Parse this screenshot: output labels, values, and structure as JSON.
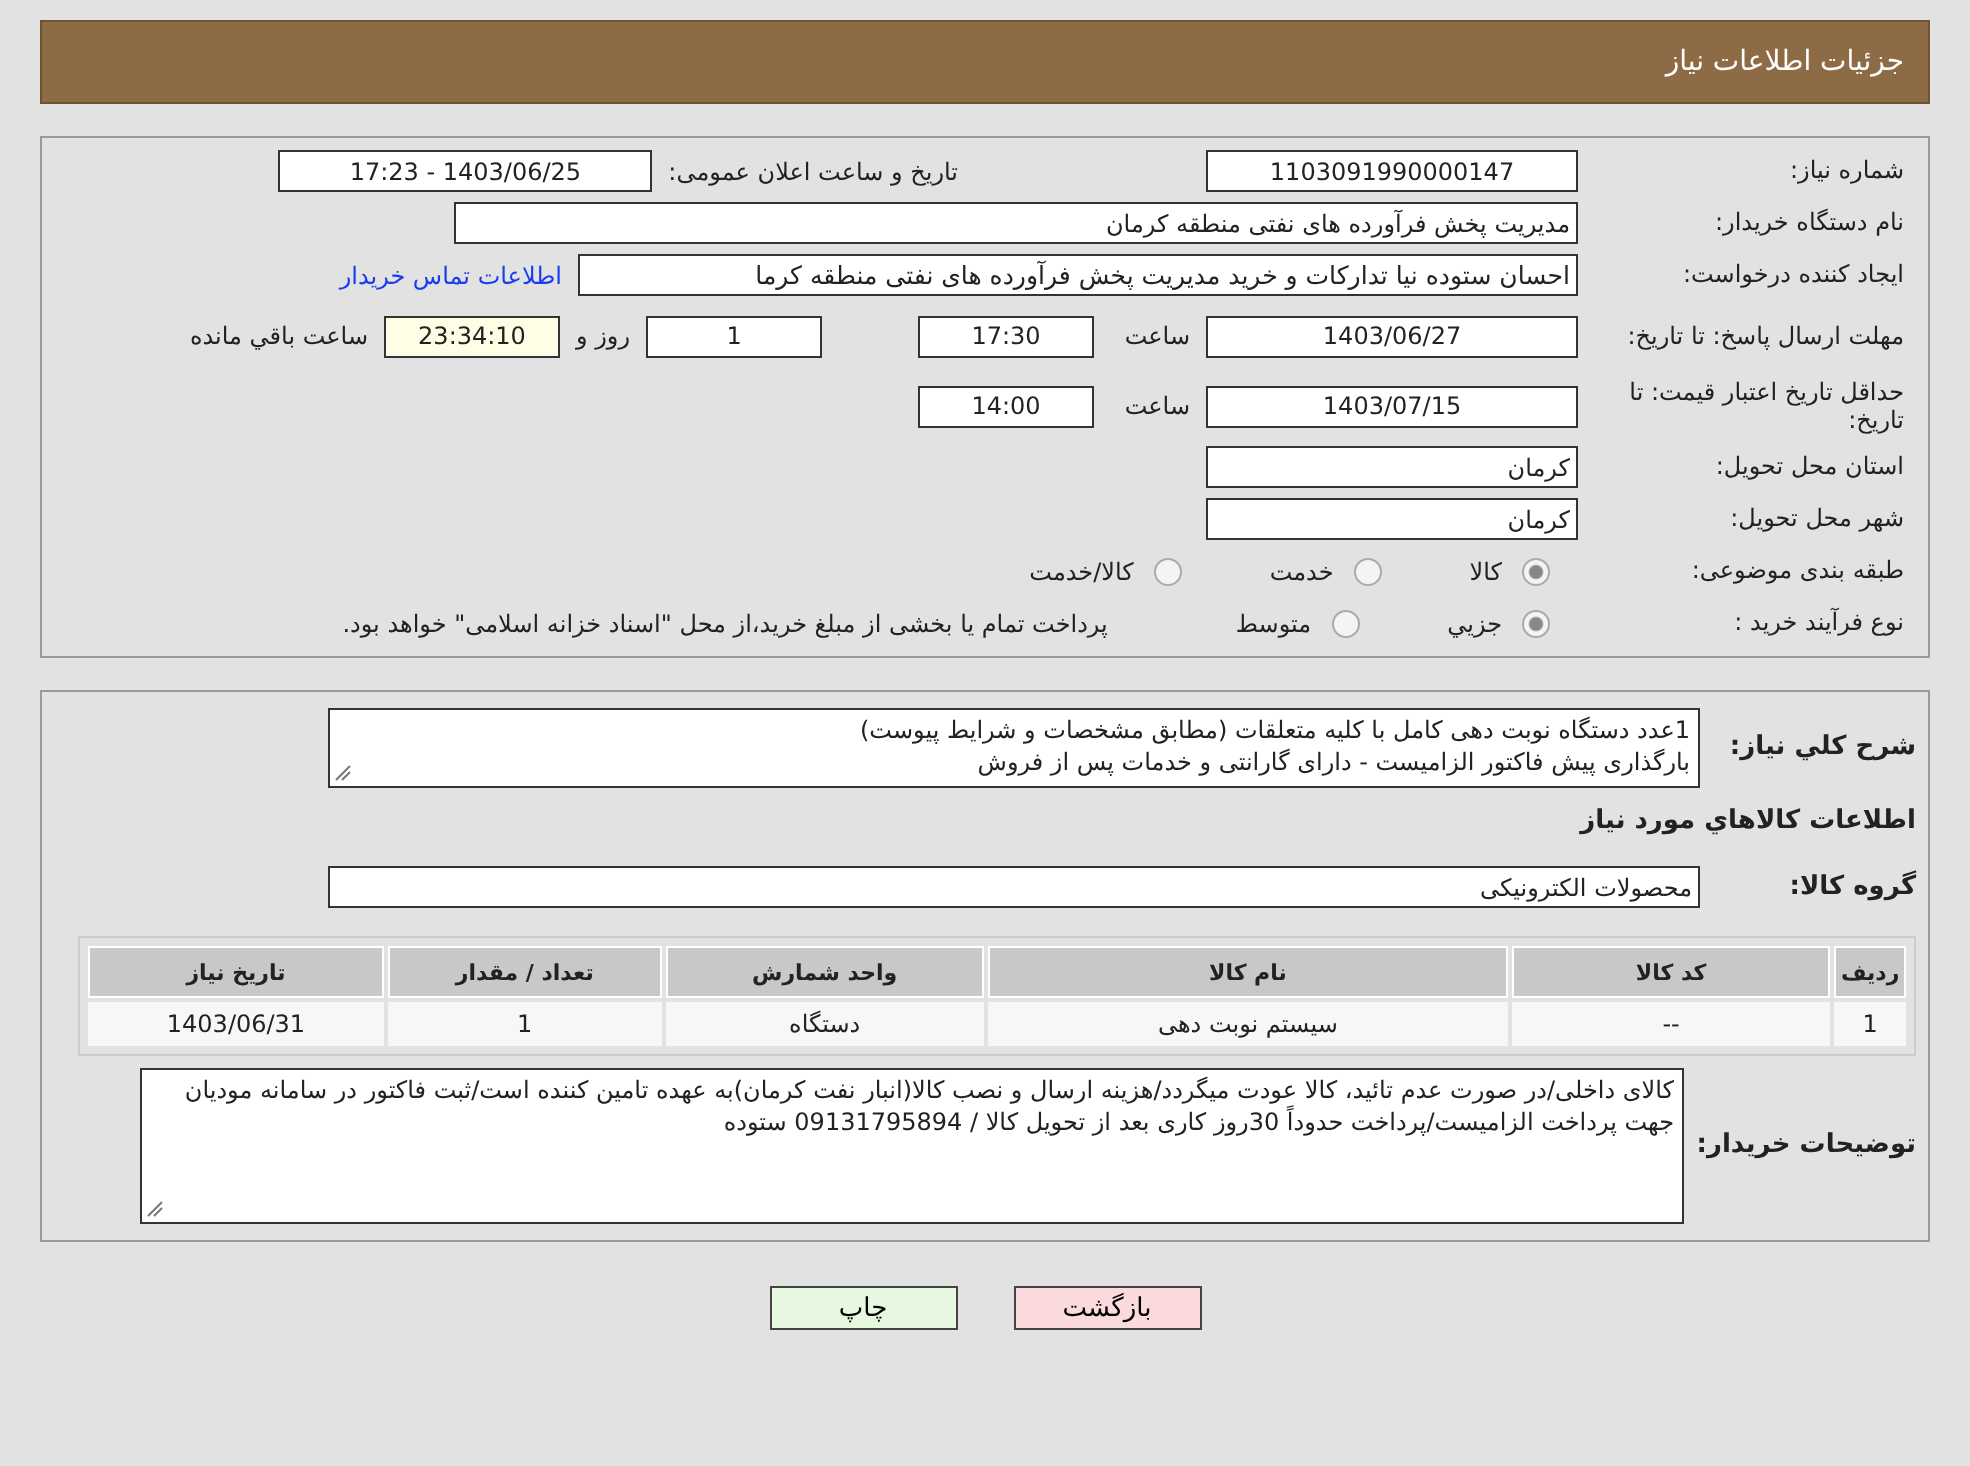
{
  "header": {
    "title": "جزئیات اطلاعات نیاز"
  },
  "need_number": {
    "label": "شماره نیاز:",
    "value": "1103091990000147"
  },
  "announce": {
    "label": "تاریخ و ساعت اعلان عمومی:",
    "value": "1403/06/25 - 17:23"
  },
  "buyer": {
    "label": "نام دستگاه خریدار:",
    "value": "مدیریت پخش فرآورده های نفتی منطقه کرمان"
  },
  "requester": {
    "label": "ایجاد کننده درخواست:",
    "value": "احسان  ستوده نیا  تدارکات و خرید  مدیریت پخش فرآورده های نفتی منطقه کرما",
    "link": "اطلاعات تماس خریدار"
  },
  "reply_deadline": {
    "label": "مهلت ارسال پاسخ: تا تاریخ:",
    "date": "1403/06/27",
    "time_label": "ساعت",
    "time": "17:30",
    "days": "1",
    "days_label": "روز و",
    "remaining": "23:34:10",
    "remaining_label": "ساعت باقي مانده"
  },
  "price_validity": {
    "label": "حداقل تاریخ اعتبار قیمت: تا تاریخ:",
    "date": "1403/07/15",
    "time_label": "ساعت",
    "time": "14:00"
  },
  "province": {
    "label": "استان محل تحویل:",
    "value": "کرمان"
  },
  "city": {
    "label": "شهر محل تحویل:",
    "value": "کرمان"
  },
  "category": {
    "label": "طبقه بندی موضوعی:",
    "options": [
      {
        "label": "کالا",
        "selected": true
      },
      {
        "label": "خدمت",
        "selected": false
      },
      {
        "label": "کالا/خدمت",
        "selected": false
      }
    ]
  },
  "purchase_type": {
    "label": "نوع فرآیند خرید :",
    "options": [
      {
        "label": "جزيي",
        "selected": true
      },
      {
        "label": "متوسط",
        "selected": false
      }
    ],
    "note": "پرداخت تمام یا بخشی از مبلغ خرید،از محل \"اسناد خزانه اسلامی\" خواهد بود."
  },
  "description": {
    "label": "شرح کلي نياز:",
    "value": "1عدد دستگاه نوبت دهی کامل با کلیه متعلقات (مطابق مشخصات و شرایط پیوست)\nبارگذاری پیش فاکتور الزامیست - دارای گارانتی و خدمات پس از فروش"
  },
  "goods_heading": "اطلاعات کالاهاي مورد نياز",
  "goods_group": {
    "label": "گروه کالا:",
    "value": "محصولات الکترونیکی"
  },
  "table": {
    "columns": [
      "ردیف",
      "کد کالا",
      "نام کالا",
      "واحد شمارش",
      "تعداد / مقدار",
      "تاریخ نیاز"
    ],
    "rows": [
      [
        "1",
        "--",
        "سیستم نوبت دهی",
        "دستگاه",
        "1",
        "1403/06/31"
      ]
    ]
  },
  "buyer_notes": {
    "label": "توضیحات خریدار:",
    "value": "کالای داخلی/در صورت عدم تائید، کالا عودت میگردد/هزینه ارسال و نصب کالا(انبار نفت کرمان)به عهده تامین کننده است/ثبت فاکتور در سامانه مودیان جهت پرداخت الزامیست/پرداخت حدوداً 30روز کاری بعد از تحویل کالا / 09131795894 ستوده"
  },
  "buttons": [
    {
      "kind": "back",
      "label": "بازگشت"
    },
    {
      "kind": "print",
      "label": "چاپ"
    }
  ]
}
